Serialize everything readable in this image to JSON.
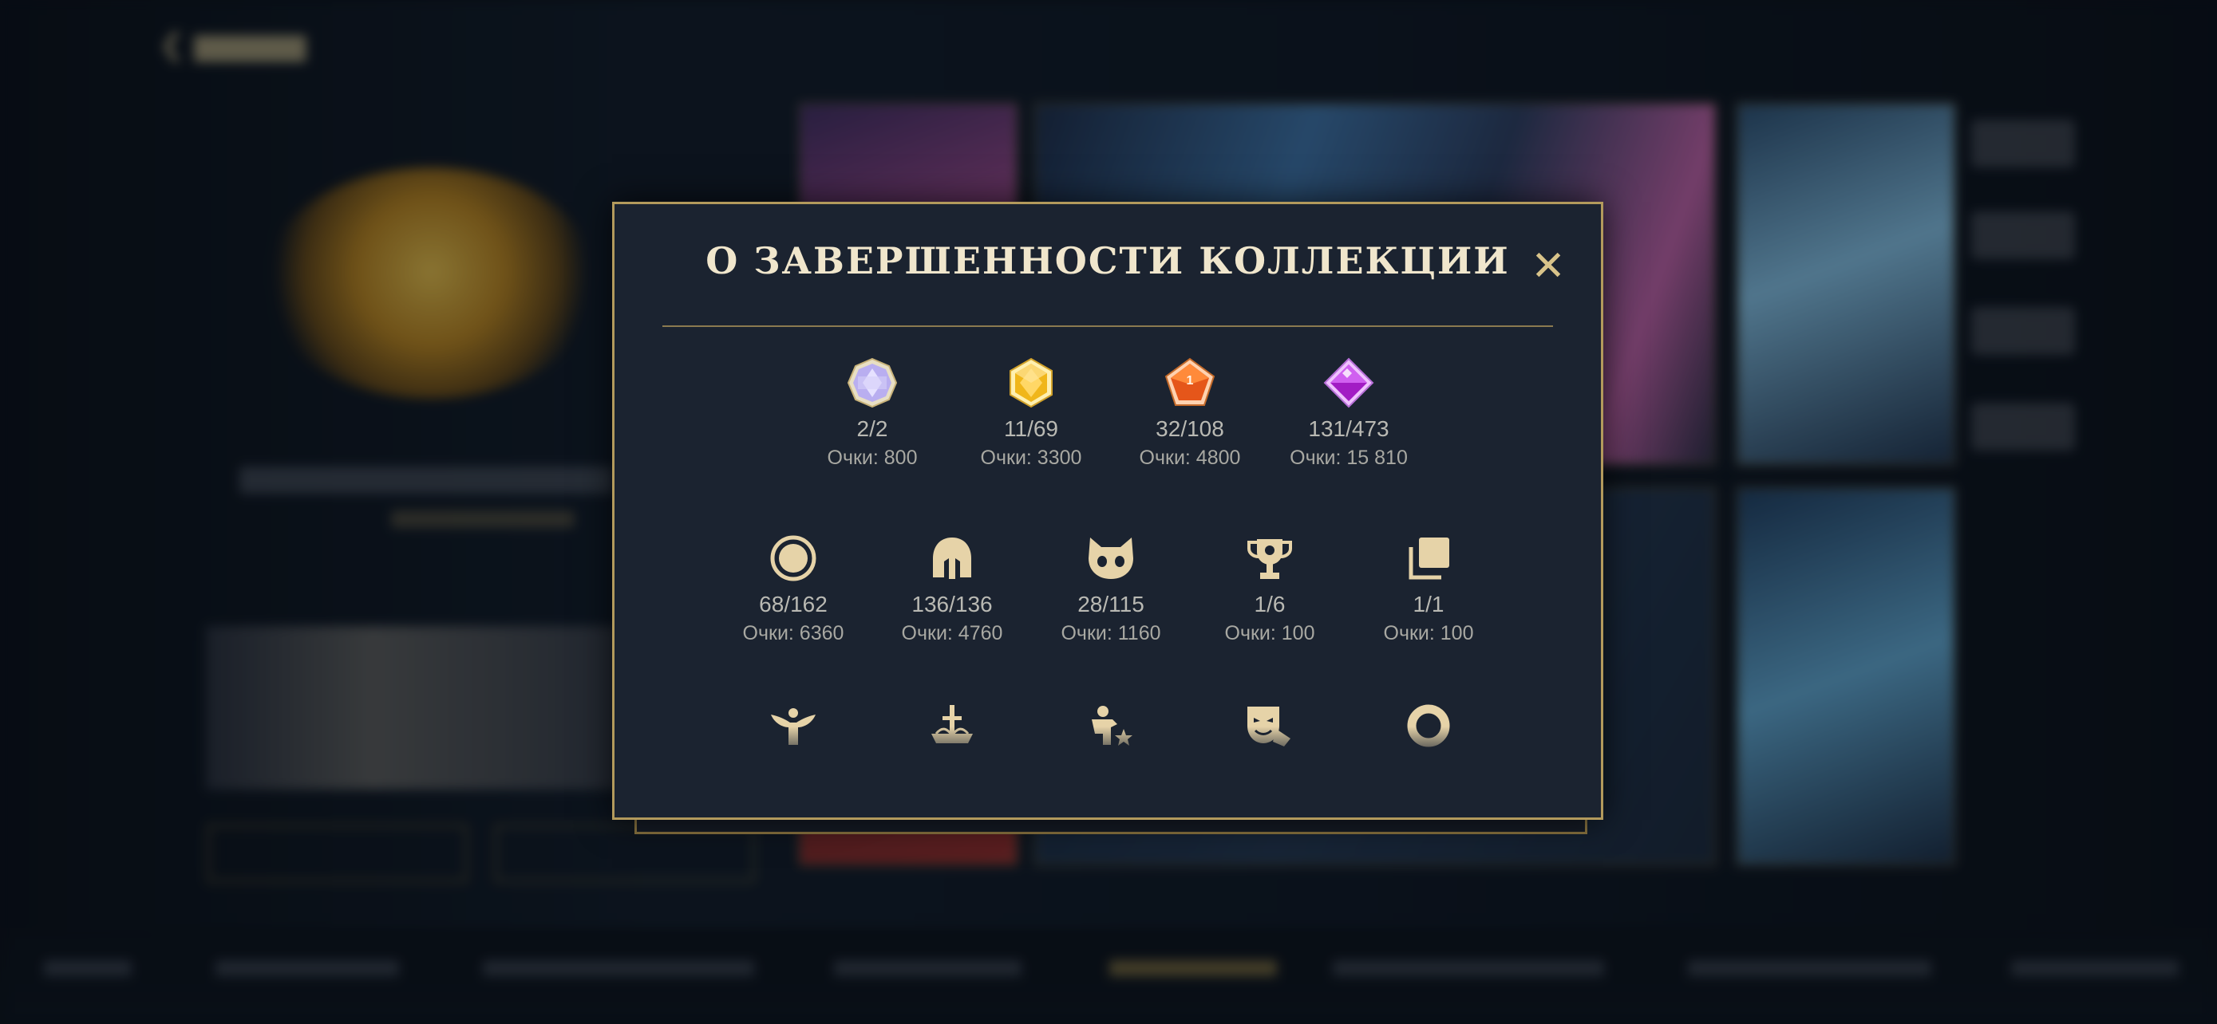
{
  "modal": {
    "title": "О ЗАВЕРШЕННОСТИ КОЛЛЕКЦИИ",
    "close_label": "✕",
    "gem_row": [
      {
        "icon": "prismatic-gem-icon",
        "count": "2/2",
        "points": "Очки: 800",
        "color": "#cfc5f2"
      },
      {
        "icon": "gold-gem-icon",
        "count": "11/69",
        "points": "Очки: 3300",
        "color": "#f1b81c"
      },
      {
        "icon": "orange-gem-icon",
        "count": "32/108",
        "points": "Очки: 4800",
        "color": "#e8641e"
      },
      {
        "icon": "purple-gem-icon",
        "count": "131/473",
        "points": "Очки: 15 810",
        "color": "#b42ed0"
      }
    ],
    "category_row": [
      {
        "icon": "circle-icon",
        "count": "68/162",
        "points": "Очки: 6360"
      },
      {
        "icon": "helmet-icon",
        "count": "136/136",
        "points": "Очки: 4760"
      },
      {
        "icon": "cat-face-icon",
        "count": "28/115",
        "points": "Очки: 1160"
      },
      {
        "icon": "trophy-icon",
        "count": "1/6",
        "points": "Очки: 100"
      },
      {
        "icon": "stacked-cards-icon",
        "count": "1/1",
        "points": "Очки: 100"
      }
    ],
    "third_row_icons": [
      "winged-figure-icon",
      "sword-emblem-icon",
      "figure-star-icon",
      "drama-mask-icon",
      "ring-icon"
    ]
  },
  "colors": {
    "accent_gold": "#b39a5c",
    "icon_beige": "#e6d3a8",
    "modal_bg": "#1b2330"
  }
}
